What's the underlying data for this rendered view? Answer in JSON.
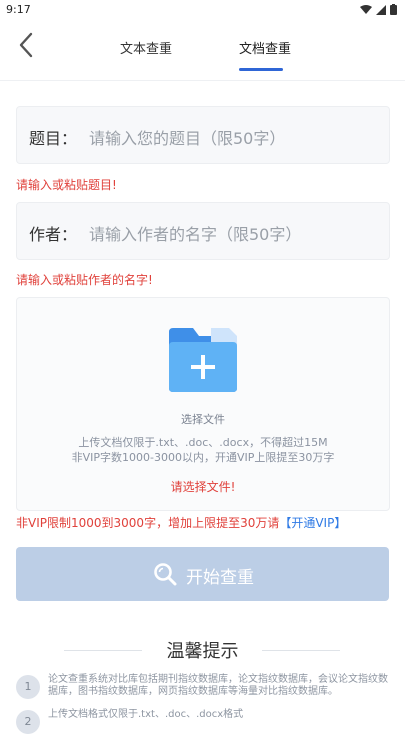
{
  "status": {
    "time": "9:17"
  },
  "header": {
    "tabs": [
      {
        "label": "文本查重"
      },
      {
        "label": "文档查重"
      }
    ]
  },
  "form": {
    "title_label": "题目：",
    "title_placeholder": "请输入您的题目（限50字）",
    "title_error": "请输入或粘贴题目!",
    "author_label": "作者：",
    "author_placeholder": "请输入作者的名字（限50字）",
    "author_error": "请输入或粘贴作者的名字!"
  },
  "upload": {
    "caption": "选择文件",
    "info_line1": "上传文档仅限于.txt、.doc、.docx，不得超过15M",
    "info_line2": "非VIP字数1000-3000以内，开通VIP上限提至30万字",
    "no_file": "请选择文件!"
  },
  "vip": {
    "text": "非VIP限制1000到3000字，增加上限提至30万请",
    "link": "【开通VIP】"
  },
  "start_button": {
    "label": "开始查重"
  },
  "tips": {
    "title": "温馨提示",
    "items": [
      {
        "num": "1",
        "text": "论文查重系统对比库包括期刊指纹数据库，论文指纹数据库，会议论文指纹数据库，图书指纹数据库，网页指纹数据库等海量对比指纹数据库。"
      },
      {
        "num": "2",
        "text": "上传文档格式仅限于.txt、.doc、.docx格式"
      }
    ]
  },
  "colors": {
    "accent": "#2f66d6",
    "error": "#e0413b",
    "button": "#bccee6",
    "link": "#2f7ae5"
  }
}
